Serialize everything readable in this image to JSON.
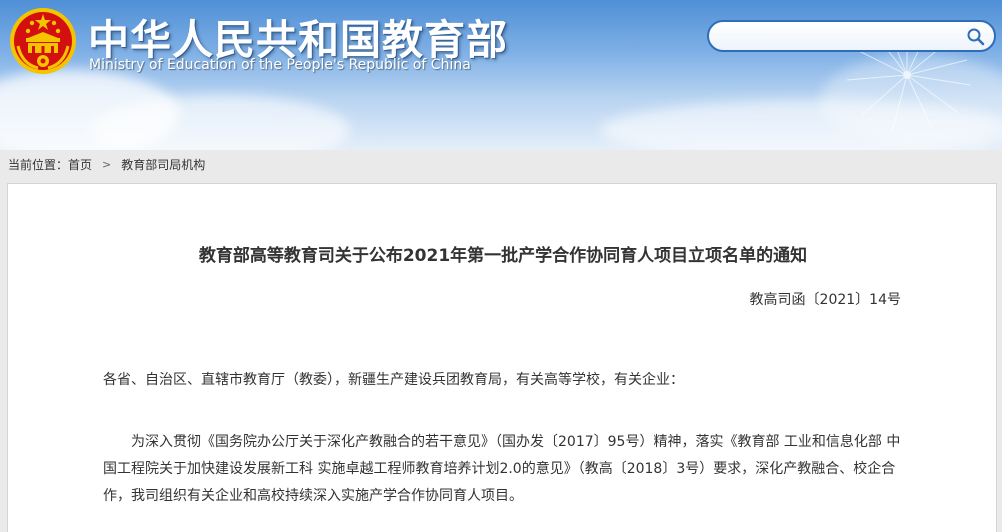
{
  "header": {
    "site_title": "中华人民共和国教育部",
    "site_subtitle": "Ministry of Education of the People's Republic of China",
    "search": {
      "value": "",
      "placeholder": ""
    }
  },
  "breadcrumb": {
    "prefix": "当前位置：",
    "items": [
      "首页",
      "教育部司局机构"
    ],
    "separator": ">"
  },
  "article": {
    "title": "教育部高等教育司关于公布2021年第一批产学合作协同育人项目立项名单的通知",
    "doc_number": "教高司函〔2021〕14号",
    "paragraphs": [
      "各省、自治区、直辖市教育厅（教委），新疆生产建设兵团教育局，有关高等学校，有关企业：",
      "为深入贯彻《国务院办公厅关于深化产教融合的若干意见》（国办发〔2017〕95号）精神，落实《教育部 工业和信息化部 中国工程院关于加快建设发展新工科 实施卓越工程师教育培养计划2.0的意见》（教高〔2018〕3号）要求，深化产教融合、校企合作，我司组织有关企业和高校持续深入实施产学合作协同育人项目。"
    ]
  },
  "colors": {
    "banner_top": "#4f8fd6",
    "title_shadow": "#2b5f9e",
    "search_border": "#2f6db8",
    "emblem_red": "#d40f0f",
    "emblem_gold": "#f5c400",
    "text": "#333333"
  },
  "icons": {
    "emblem": "national-emblem-icon",
    "search": "search-icon"
  }
}
